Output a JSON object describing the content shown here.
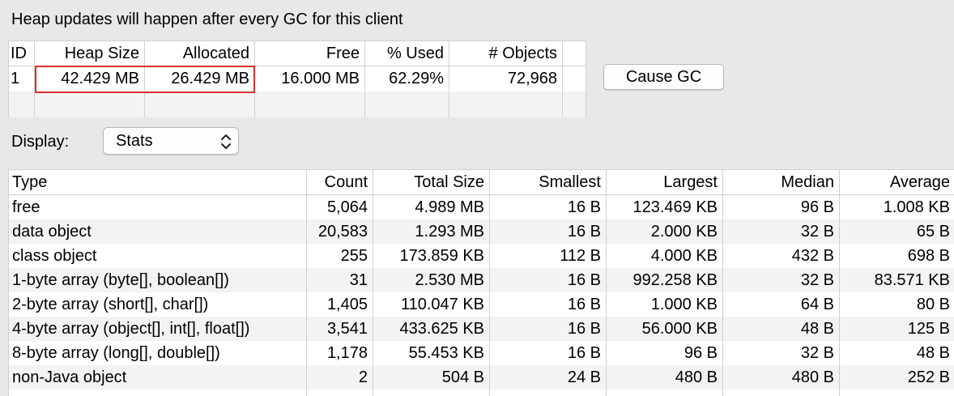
{
  "notice": "Heap updates will happen after every GC for this client",
  "heap_table": {
    "headers": [
      "ID",
      "Heap Size",
      "Allocated",
      "Free",
      "% Used",
      "# Objects"
    ],
    "rows": [
      [
        "1",
        "42.429 MB",
        "26.429 MB",
        "16.000 MB",
        "62.29%",
        "72,968"
      ]
    ]
  },
  "cause_gc_label": "Cause GC",
  "display": {
    "label": "Display:",
    "selected": "Stats"
  },
  "stats_table": {
    "headers": [
      "Type",
      "Count",
      "Total Size",
      "Smallest",
      "Largest",
      "Median",
      "Average"
    ],
    "rows": [
      [
        "free",
        "5,064",
        "4.989 MB",
        "16 B",
        "123.469 KB",
        "96 B",
        "1.008 KB"
      ],
      [
        "data object",
        "20,583",
        "1.293 MB",
        "16 B",
        "2.000 KB",
        "32 B",
        "65 B"
      ],
      [
        "class object",
        "255",
        "173.859 KB",
        "112 B",
        "4.000 KB",
        "432 B",
        "698 B"
      ],
      [
        "1-byte array (byte[], boolean[])",
        "31",
        "2.530 MB",
        "16 B",
        "992.258 KB",
        "32 B",
        "83.571 KB"
      ],
      [
        "2-byte array (short[], char[])",
        "1,405",
        "110.047 KB",
        "16 B",
        "1.000 KB",
        "64 B",
        "80 B"
      ],
      [
        "4-byte array (object[], int[], float[])",
        "3,541",
        "433.625 KB",
        "16 B",
        "56.000 KB",
        "48 B",
        "125 B"
      ],
      [
        "8-byte array (long[], double[])",
        "1,178",
        "55.453 KB",
        "16 B",
        "96 B",
        "32 B",
        "48 B"
      ],
      [
        "non-Java object",
        "2",
        "504 B",
        "24 B",
        "480 B",
        "480 B",
        "252 B"
      ]
    ]
  },
  "colors": {
    "highlight": "#d9302a",
    "window_bg": "#e8e8e8",
    "row_alt": "#f3f3f3"
  },
  "icons": {
    "select_chevron": "chevron-up-down-icon"
  }
}
